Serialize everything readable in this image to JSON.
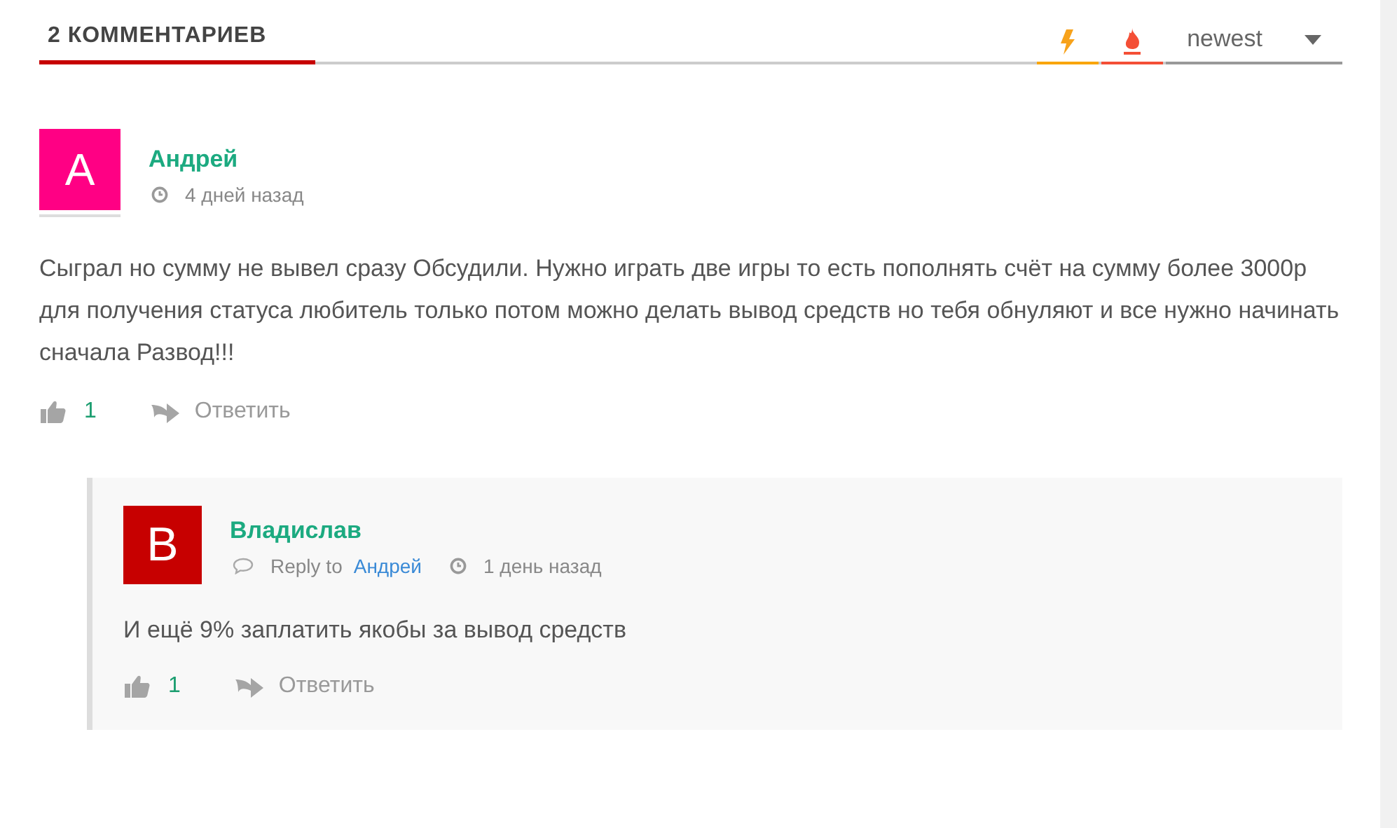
{
  "header": {
    "title": "2 КОММЕНТАРИЕВ",
    "sort": "newest"
  },
  "comments": [
    {
      "avatar": "A",
      "color": "#ff0084",
      "author": "Андрей",
      "time": "4 дней назад",
      "text": "Сыграл но сумму не вывел сразу Обсудили. Нужно играть две игры то есть пополнять счёт на сумму более 3000р для получения статуса любитель только потом можно делать вывод средств но тебя обнуляют и все нужно начинать сначала Развод!!!",
      "likes": "1",
      "reply": "Ответить",
      "children": [
        {
          "avatar": "B",
          "color": "#c70000",
          "author": "Владислав",
          "reply_to_label": "Reply to",
          "reply_to": "Андрей",
          "time": "1 день назад",
          "text": "И ещё 9% заплатить якобы за вывод средств",
          "likes": "1",
          "reply": "Ответить"
        }
      ]
    }
  ]
}
